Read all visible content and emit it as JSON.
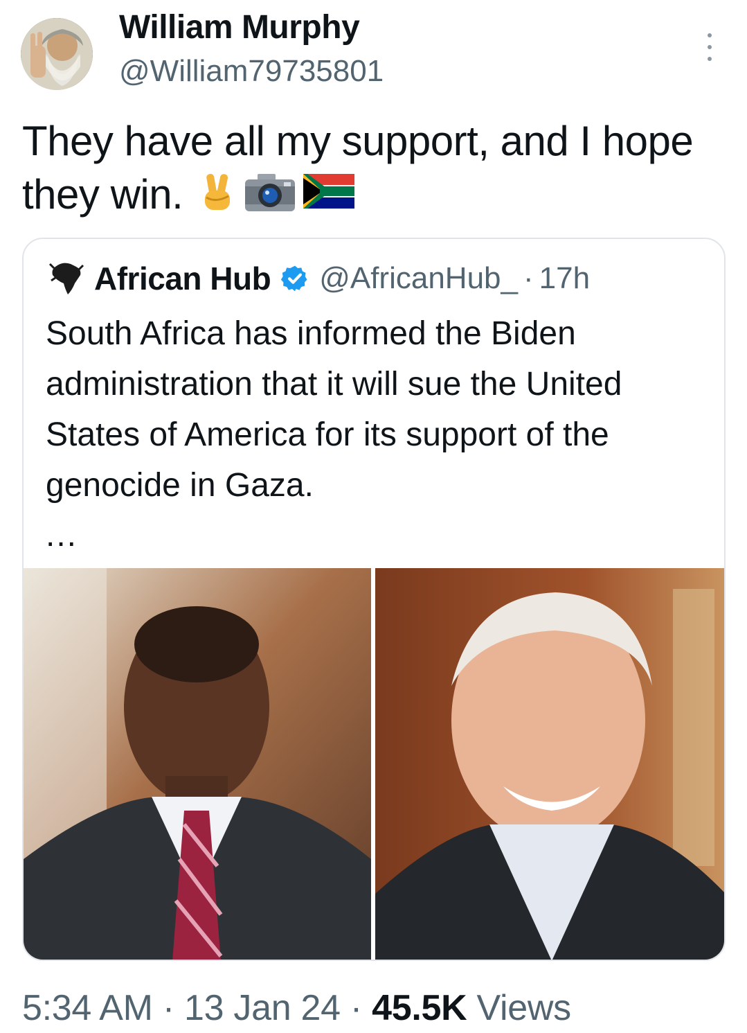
{
  "author": {
    "display_name": "William Murphy",
    "handle": "@William79735801",
    "avatar_icon": "bearded-man-peace-sign-avatar"
  },
  "tweet": {
    "text": "They have all my support, and I hope they win.",
    "emojis": [
      "victory-hand-emoji",
      "camera-emoji",
      "south-africa-flag-emoji"
    ]
  },
  "quote": {
    "name": "African Hub",
    "verified": true,
    "handle": "@AfricanHub_",
    "separator": "·",
    "time": "17h",
    "text": "South Africa has informed the Biden administration that it will sue the United States of America for its support of the genocide in Gaza.",
    "ellipsis": "...",
    "logo_icon": "africa-continent-logo-icon",
    "photos": [
      "photo-man-in-dark-suit-striped-tie",
      "photo-smiling-man-in-suit"
    ]
  },
  "meta": {
    "time": "5:34 AM",
    "sep1": "·",
    "date": "13 Jan 24",
    "sep2": "·",
    "views_count": "45.5K",
    "views_label": "Views"
  },
  "colors": {
    "text_primary": "#0f1419",
    "text_secondary": "#536471",
    "verified_blue": "#1d9bf0",
    "card_border": "#e1e5e9"
  }
}
